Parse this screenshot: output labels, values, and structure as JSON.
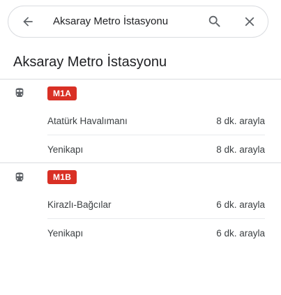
{
  "search": {
    "query": "Aksaray Metro İstasyonu"
  },
  "station": {
    "title": "Aksaray Metro İstasyonu"
  },
  "colors": {
    "badge": "#d93025",
    "icon": "#5f6368"
  },
  "icons": {
    "back": "arrow-back-icon",
    "search": "search-icon",
    "close": "close-icon",
    "transit": "metro-icon"
  },
  "lines": [
    {
      "name": "M1A",
      "departures": [
        {
          "destination": "Atatürk Havalımanı",
          "frequency": "8 dk. arayla"
        },
        {
          "destination": "Yenikapı",
          "frequency": "8 dk. arayla"
        }
      ]
    },
    {
      "name": "M1B",
      "departures": [
        {
          "destination": "Kirazlı-Bağcılar",
          "frequency": "6 dk. arayla"
        },
        {
          "destination": "Yenikapı",
          "frequency": "6 dk. arayla"
        }
      ]
    }
  ]
}
